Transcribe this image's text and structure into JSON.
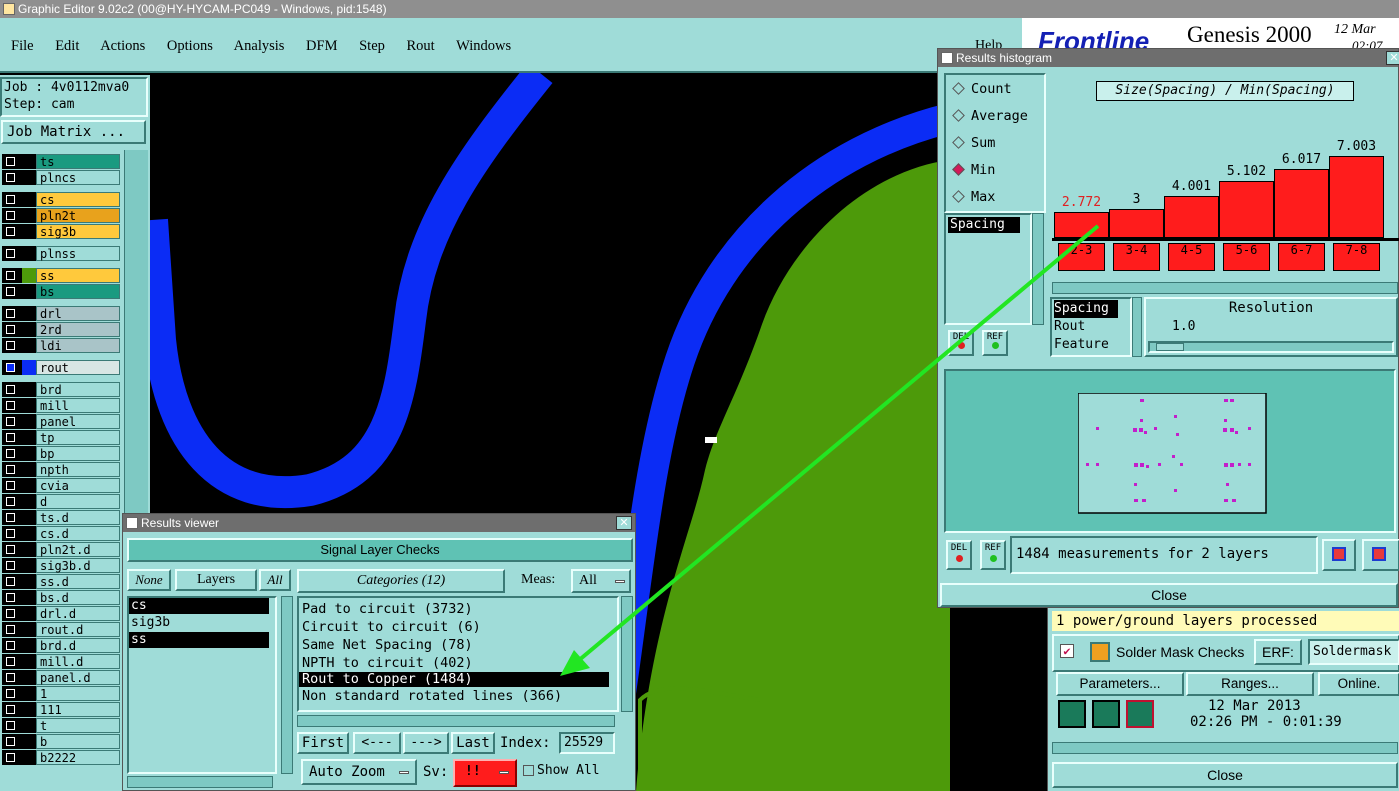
{
  "window": {
    "title": "Graphic Editor 9.02c2 (00@HY-HYCAM-PC049 - Windows, pid:1548)"
  },
  "menu": [
    "File",
    "Edit",
    "Actions",
    "Options",
    "Analysis",
    "DFM",
    "Step",
    "Rout",
    "Windows"
  ],
  "help": "Help",
  "brand": {
    "logo": "Frontline",
    "product": "Genesis 2000",
    "date": "12 Mar",
    "time": "02:07"
  },
  "job": {
    "job": "Job : 4v0112mva0",
    "step": "Step: cam",
    "matrix_button": "Job Matrix ..."
  },
  "layers": [
    {
      "name": "ts",
      "color": "#1a9a80"
    },
    {
      "name": "plncs",
      "color": "#9fdcd8"
    },
    {
      "name": "cs",
      "color": "#ffc93c"
    },
    {
      "name": "pln2t",
      "color": "#e8a21c"
    },
    {
      "name": "sig3b",
      "color": "#ffc93c"
    },
    {
      "name": "plnss",
      "color": "#9fdcd8"
    },
    {
      "name": "ss",
      "color": "#ffc93c"
    },
    {
      "name": "bs",
      "color": "#1a9a80"
    },
    {
      "name": "drl",
      "color": "#a9c4c8"
    },
    {
      "name": "2rd",
      "color": "#a9c4c8"
    },
    {
      "name": "ldi",
      "color": "#a9c4c8"
    },
    {
      "name": "rout",
      "color": "#d8e6e4"
    },
    {
      "name": "brd",
      "color": "#9fdcd8"
    },
    {
      "name": "mill",
      "color": "#9fdcd8"
    },
    {
      "name": "panel",
      "color": "#9fdcd8"
    },
    {
      "name": "tp",
      "color": "#9fdcd8"
    },
    {
      "name": "bp",
      "color": "#9fdcd8"
    },
    {
      "name": "npth",
      "color": "#9fdcd8"
    },
    {
      "name": "cvia",
      "color": "#9fdcd8"
    },
    {
      "name": "d",
      "color": "#9fdcd8"
    },
    {
      "name": "ts.d",
      "color": "#9fdcd8"
    },
    {
      "name": "cs.d",
      "color": "#9fdcd8"
    },
    {
      "name": "pln2t.d",
      "color": "#9fdcd8"
    },
    {
      "name": "sig3b.d",
      "color": "#9fdcd8"
    },
    {
      "name": "ss.d",
      "color": "#9fdcd8"
    },
    {
      "name": "bs.d",
      "color": "#9fdcd8"
    },
    {
      "name": "drl.d",
      "color": "#9fdcd8"
    },
    {
      "name": "rout.d",
      "color": "#9fdcd8"
    },
    {
      "name": "brd.d",
      "color": "#9fdcd8"
    },
    {
      "name": "mill.d",
      "color": "#9fdcd8"
    },
    {
      "name": "panel.d",
      "color": "#9fdcd8"
    },
    {
      "name": "1",
      "color": "#9fdcd8"
    },
    {
      "name": "111",
      "color": "#9fdcd8"
    },
    {
      "name": "t",
      "color": "#9fdcd8"
    },
    {
      "name": "b",
      "color": "#9fdcd8"
    },
    {
      "name": "b2222",
      "color": "#9fdcd8"
    }
  ],
  "results_viewer": {
    "title": "Results viewer",
    "header": "Signal Layer Checks",
    "none_btn": "None",
    "layers_label": "Layers",
    "all_btn": "All",
    "layer_list": [
      "cs",
      "sig3b",
      "ss"
    ],
    "categories_label": "Categories (12)",
    "meas_label": "Meas:",
    "meas_value": "All",
    "categories": [
      "Pad to circuit (3732)",
      "Circuit to circuit (6)",
      "Same Net Spacing (78)",
      "NPTH to circuit (402)",
      "Rout to Copper (1484)",
      "Non standard rotated lines (366)"
    ],
    "first_btn": "First",
    "prev_btn": "<---",
    "next_btn": "--->",
    "last_btn": "Last",
    "index_label": "Index:",
    "index_value": "25529",
    "auto_zoom": "Auto Zoom",
    "sv_label": "Sv:",
    "sv_value": "!!",
    "show_all": "Show All"
  },
  "histogram": {
    "title": "Results histogram",
    "stats": [
      "Count",
      "Average",
      "Sum",
      "Min",
      "Max"
    ],
    "selected_stat": "Min",
    "chart_title": "Size(Spacing) / Min(Spacing)",
    "measure_list": [
      "Spacing"
    ],
    "del_btn": "DEL",
    "ref_btn": "REF",
    "type_list": [
      "Spacing",
      "Rout",
      "Feature"
    ],
    "resolution_label": "Resolution",
    "resolution_value": "1.0",
    "measurements": "1484 measurements for 2 layers",
    "close": "Close"
  },
  "chart_data": {
    "type": "bar",
    "title": "Size(Spacing) / Min(Spacing)",
    "categories": [
      "2-3",
      "3-4",
      "4-5",
      "5-6",
      "6-7",
      "7-8"
    ],
    "values": [
      2.772,
      3,
      4.001,
      5.102,
      6.017,
      7.003
    ],
    "value_labels": [
      "2.772",
      "3",
      "4.001",
      "5.102",
      "6.017",
      "7.003"
    ],
    "ylim": [
      0,
      7.5
    ],
    "highlight_index": 0,
    "bar_color": "#ff1c1c",
    "highlight_color": "#ff1c1c"
  },
  "solder": {
    "status": "1 power/ground layers processed",
    "check_label": "Solder Mask Checks",
    "erf_label": "ERF:",
    "erf_value": "Soldermask",
    "params_btn": "Parameters...",
    "ranges_btn": "Ranges...",
    "online_btn": "Online.",
    "date": "12 Mar 2013",
    "time": "02:26 PM - 0:01:39",
    "close": "Close"
  },
  "colors": {
    "panel": "#9fdcd8",
    "copper": "#4d9a0a",
    "rout": "#0b2cf5",
    "arrow": "#22e622",
    "bar": "#ff1c1c"
  }
}
